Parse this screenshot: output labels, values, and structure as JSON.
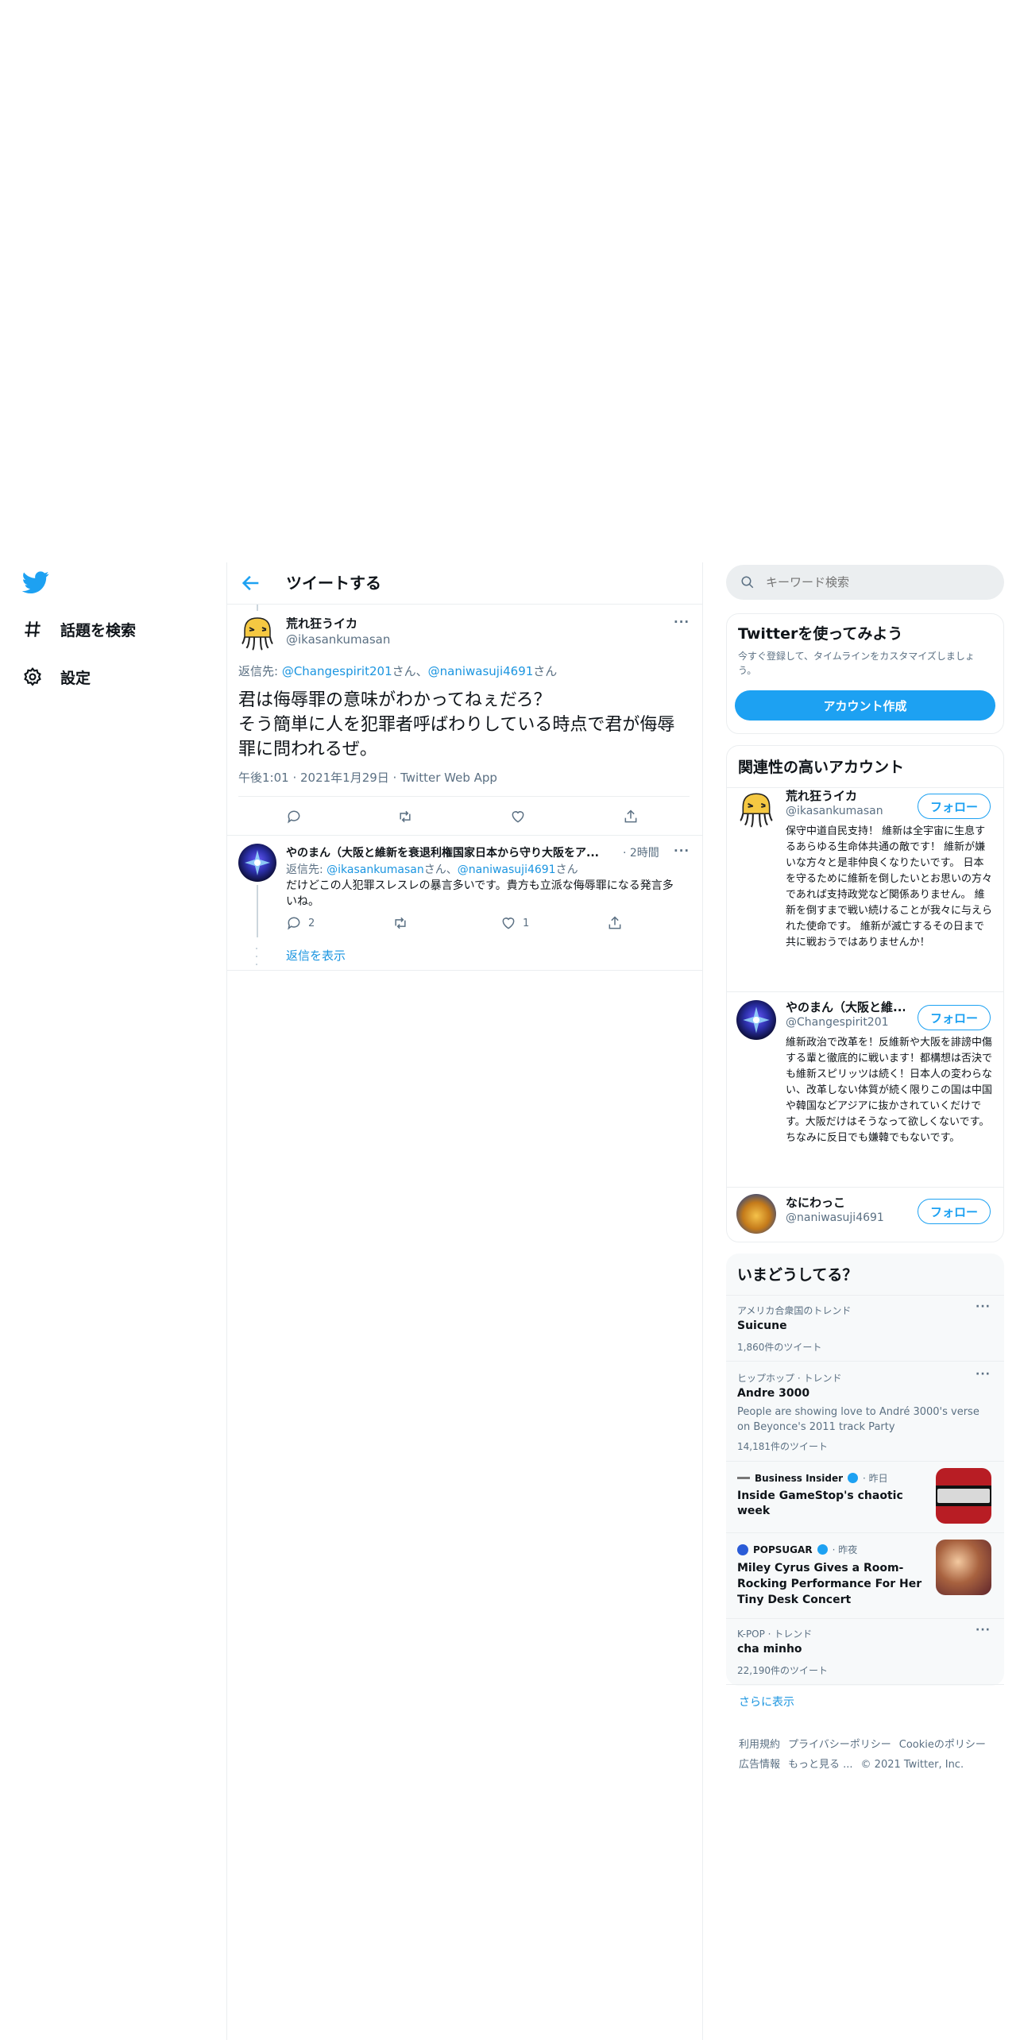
{
  "nav": {
    "items": [
      {
        "label": "話題を検索",
        "icon": "hashtag-icon"
      },
      {
        "label": "設定",
        "icon": "gear-icon"
      }
    ]
  },
  "main": {
    "title": "ツイートする",
    "tweet": {
      "name": "荒れ狂うイカ",
      "handle": "@ikasankumasan",
      "reply_prefix": "返信先: ",
      "reply_to_1": "@Changespirit201",
      "san_1": "さん、",
      "reply_to_2": "@naniwasuji4691",
      "san_2": "さん",
      "text_line1": "君は侮辱罪の意味がわかってねぇだろ？",
      "text_line2": "そう簡単に人を犯罪者呼ばわりしている時点で君が侮辱罪に問われるぜ。",
      "meta": "午後1:01 · 2021年1月29日 · Twitter Web App",
      "more": "···"
    },
    "reply": {
      "name": "やのまん（大阪と維新を衰退利権国家日本から守り大阪をア...",
      "time": "· 2時間",
      "reply_prefix": "返信先: ",
      "reply_to_1": "@ikasankumasan",
      "san_1": "さん、",
      "reply_to_2": "@naniwasuji4691",
      "san_2": "さん",
      "text": "だけどこの人犯罪スレスレの暴言多いです。貴方も立派な侮辱罪になる発言多いね。",
      "reply_count": "2",
      "like_count": "1",
      "show_replies": "返信を表示",
      "more": "···"
    }
  },
  "search": {
    "placeholder": "キーワード検索"
  },
  "signup": {
    "title": "Twitterを使ってみよう",
    "desc": "今すぐ登録して、タイムラインをカスタマイズしましょう。",
    "button": "アカウント作成"
  },
  "related": {
    "title": "関連性の高いアカウント",
    "follow_label": "フォロー",
    "accounts": [
      {
        "name": "荒れ狂うイカ",
        "handle": "@ikasankumasan",
        "bio": "保守中道自民支持！ 維新は全宇宙に生息するあらゆる生命体共通の敵です！ 維新が嫌いな方々と是非仲良くなりたいです。 日本を守るために維新を倒したいとお思いの方々であれば支持政党など関係ありません。 維新を倒すまで戦い続けることが我々に与えられた使命です。 維新が滅亡するその日まで共に戦おうではありませんか！"
      },
      {
        "name": "やのまん（大阪と維...",
        "handle": "@Changespirit201",
        "bio": "維新政治で改革を！反維新や大阪を誹謗中傷する輩と徹底的に戦います！都構想は否決でも維新スピリッツは続く！日本人の変わらない、改革しない体質が続く限りこの国は中国や韓国などアジアに抜かされていくだけです。大阪だけはそうなって欲しくないです。ちなみに反日でも嫌韓でもないです。"
      },
      {
        "name": "なにわっこ",
        "handle": "@naniwasuji4691",
        "bio": ""
      }
    ]
  },
  "trends": {
    "title": "いまどうしてる？",
    "show_more": "さらに表示",
    "items": [
      {
        "context": "アメリカ合衆国のトレンド",
        "name": "Suicune",
        "count": "1,860件のツイート"
      },
      {
        "context": "ヒップホップ · トレンド",
        "name": "Andre 3000",
        "desc": "People are showing love to André 3000's verse on Beyonce's 2011 track Party",
        "count": "14,181件のツイート"
      },
      {
        "source": "Business Insider",
        "when": "· 昨日",
        "headline": "Inside GameStop's chaotic week"
      },
      {
        "source": "POPSUGAR",
        "when": "· 昨夜",
        "headline": "Miley Cyrus Gives a Room-Rocking Performance For Her Tiny Desk Concert"
      },
      {
        "context": "K-POP · トレンド",
        "name": "cha minho",
        "count": "22,190件のツイート"
      }
    ]
  },
  "footer": {
    "links": [
      "利用規約",
      "プライバシーポリシー",
      "Cookieのポリシー"
    ],
    "links2": [
      "広告情報",
      "もっと見る ..."
    ],
    "copyright": "© 2021 Twitter, Inc."
  },
  "colors": {
    "accent": "#1da1f2",
    "link": "#1b95e0",
    "muted": "#5b7083",
    "border": "#ebeef0",
    "card": "#f7f9fa"
  }
}
